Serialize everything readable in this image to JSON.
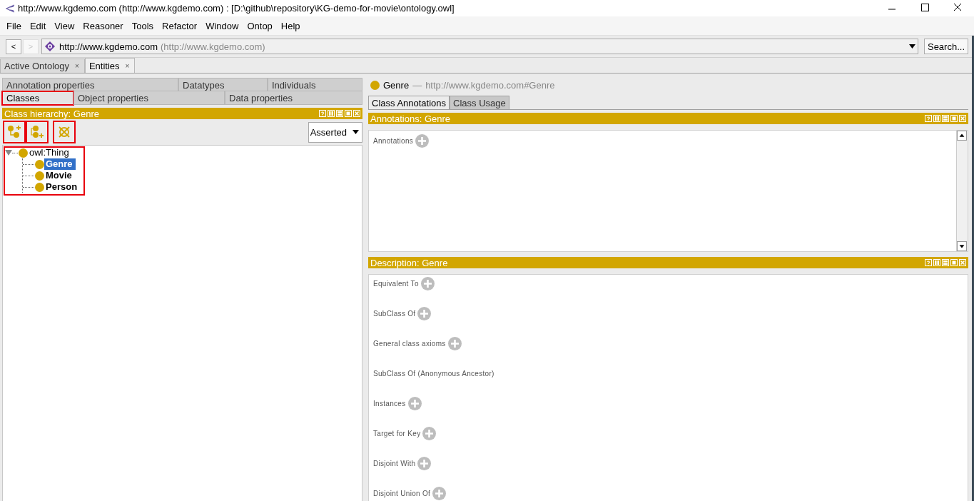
{
  "window": {
    "title": "http://www.kgdemo.com (http://www.kgdemo.com)  : [D:\\github\\repository\\KG-demo-for-movie\\ontology.owl]"
  },
  "menu": [
    "File",
    "Edit",
    "View",
    "Reasoner",
    "Tools",
    "Refactor",
    "Window",
    "Ontop",
    "Help"
  ],
  "address": {
    "back": "<",
    "forward": ">",
    "value": "http://www.kgdemo.com",
    "hint": "(http://www.kgdemo.com)",
    "search": "Search..."
  },
  "workspace_tabs": [
    {
      "label": "Active Ontology",
      "close": "×",
      "selected": false
    },
    {
      "label": "Entities",
      "close": "×",
      "selected": true
    }
  ],
  "entity_tabs": [
    [
      {
        "label": "Annotation properties",
        "selected": false,
        "highlighted": false
      },
      {
        "label": "Datatypes",
        "selected": false,
        "highlighted": false
      },
      {
        "label": "Individuals",
        "selected": false,
        "highlighted": false
      }
    ],
    [
      {
        "label": "Classes",
        "selected": true,
        "highlighted": true
      },
      {
        "label": "Object properties",
        "selected": false,
        "highlighted": false
      },
      {
        "label": "Data properties",
        "selected": false,
        "highlighted": false
      }
    ]
  ],
  "class_hierarchy": {
    "title": "Class hierarchy: Genre",
    "toolbar": [
      {
        "kind": "add-subclass",
        "highlighted": true
      },
      {
        "kind": "add-sibling",
        "highlighted": true
      },
      {
        "kind": "delete",
        "highlighted": true
      }
    ],
    "mode": "Asserted",
    "tree_highlighted": true,
    "tree": [
      {
        "label": "owl:Thing",
        "expanded": true,
        "selected": false,
        "children": [
          {
            "label": "Genre",
            "selected": true
          },
          {
            "label": "Movie",
            "selected": false
          },
          {
            "label": "Person",
            "selected": false
          }
        ]
      }
    ]
  },
  "entity": {
    "name": "Genre",
    "separator": "—",
    "iri": "http://www.kgdemo.com#Genre"
  },
  "view_tabs": [
    {
      "label": "Class Annotations",
      "selected": true
    },
    {
      "label": "Class Usage",
      "selected": false
    }
  ],
  "annotations": {
    "title": "Annotations: Genre",
    "label": "Annotations"
  },
  "description": {
    "title": "Description: Genre",
    "sections": [
      {
        "label": "Equivalent To",
        "addable": true
      },
      {
        "label": "SubClass Of",
        "addable": true
      },
      {
        "label": "General class axioms",
        "addable": true
      },
      {
        "label": "SubClass Of (Anonymous Ancestor)",
        "addable": false
      },
      {
        "label": "Instances",
        "addable": true
      },
      {
        "label": "Target for Key",
        "addable": true
      },
      {
        "label": "Disjoint With",
        "addable": true
      },
      {
        "label": "Disjoint Union Of",
        "addable": true
      }
    ]
  }
}
